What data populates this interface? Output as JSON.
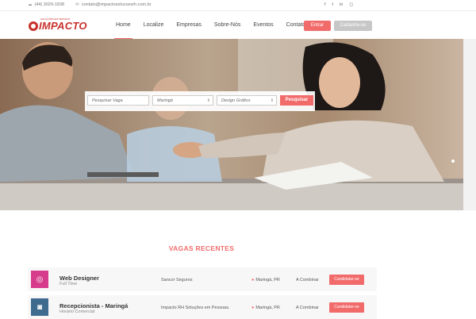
{
  "topbar": {
    "phone": "(44) 3029-1838",
    "email": "contato@impactosolucoesrh.com.br",
    "social": [
      "f",
      "t",
      "in",
      "ig"
    ]
  },
  "brand": {
    "name": "IMPACTO",
    "tagline": "SOLUÇÕES EM PESSOAS"
  },
  "nav": {
    "items": [
      {
        "label": "Home",
        "active": true
      },
      {
        "label": "Localize"
      },
      {
        "label": "Empresas"
      },
      {
        "label": "Sobre-Nós"
      },
      {
        "label": "Eventos"
      },
      {
        "label": "Contato"
      }
    ],
    "login_label": "Entrar",
    "signup_label": "Cadastre-se"
  },
  "search": {
    "keyword_placeholder": "Pesquisar Vaga",
    "city_value": "Maringá",
    "area_value": "Design Gráfico",
    "button_label": "Pesquisar"
  },
  "recent": {
    "title": "VAGAS RECENTES",
    "jobs": [
      {
        "title": "Web Designer",
        "type": "Full Time",
        "company": "Sancor Seguros",
        "location": "Maringá, PR",
        "salary": "A Combinar",
        "action": "Candidatar-se",
        "icon": "dribbble-icon",
        "icon_color": "#d63c8b"
      },
      {
        "title": "Recepcionista - Maringá",
        "type": "Horário Comercial",
        "company": "Impacto RH Soluções em Pessoas.",
        "location": "Maringá, PR",
        "salary": "A Combinar",
        "action": "Candidatar-se",
        "icon": "instagram-icon",
        "icon_color": "#3f6b8f"
      }
    ]
  },
  "colors": {
    "accent": "#f26b6b",
    "brand": "#c9302c"
  }
}
